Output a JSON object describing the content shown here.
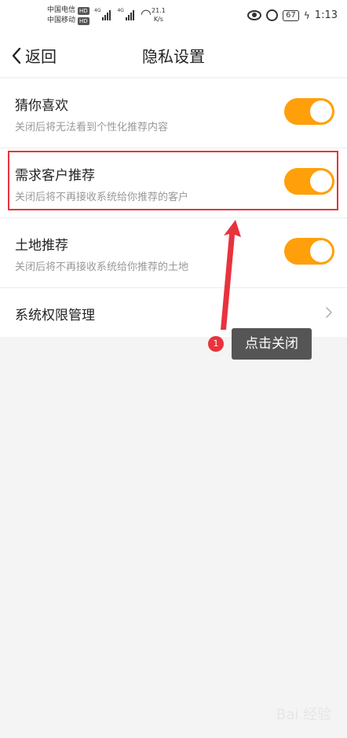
{
  "status_bar": {
    "carrier1": "中国电信",
    "carrier2": "中国移动",
    "hd_badge": "HD",
    "signal_label": "4G",
    "speed_value": "21.1",
    "speed_unit": "K/s",
    "battery": "67",
    "time": "1:13"
  },
  "nav": {
    "back_label": "返回",
    "title": "隐私设置"
  },
  "settings": {
    "items": [
      {
        "title": "猜你喜欢",
        "subtitle": "关闭后将无法看到个性化推荐内容",
        "enabled": true
      },
      {
        "title": "需求客户推荐",
        "subtitle": "关闭后将不再接收系统给你推荐的客户",
        "enabled": true
      },
      {
        "title": "土地推荐",
        "subtitle": "关闭后将不再接收系统给你推荐的土地",
        "enabled": true
      }
    ],
    "permissions_label": "系统权限管理"
  },
  "annotation": {
    "step_number": "1",
    "tooltip": "点击关闭"
  },
  "colors": {
    "toggle_on": "#ff9f0a",
    "highlight": "#e8333d",
    "tooltip_bg": "#555555"
  },
  "watermark": "Bai 经验"
}
